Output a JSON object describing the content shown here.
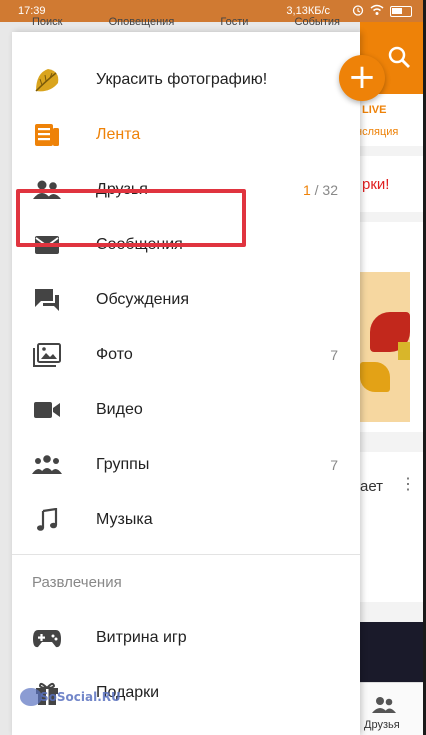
{
  "status_bar": {
    "time": "17:39",
    "network_speed": "3,13КБ/с"
  },
  "top_tabs": [
    "Поиск",
    "Оповещения",
    "Гости",
    "События"
  ],
  "menu": {
    "items": [
      {
        "label": "Украсить фотографию!",
        "icon": "leaf-icon",
        "count": ""
      },
      {
        "label": "Лента",
        "icon": "feed-icon",
        "count": ""
      },
      {
        "label": "Друзья",
        "icon": "friends-icon",
        "count_new": "1",
        "count_sep": " / ",
        "count_total": "32"
      },
      {
        "label": "Сообщения",
        "icon": "envelope-icon",
        "count": ""
      },
      {
        "label": "Обсуждения",
        "icon": "chat-icon",
        "count": ""
      },
      {
        "label": "Фото",
        "icon": "photo-icon",
        "count": "7"
      },
      {
        "label": "Видео",
        "icon": "video-icon",
        "count": ""
      },
      {
        "label": "Группы",
        "icon": "groups-icon",
        "count": "7"
      },
      {
        "label": "Музыка",
        "icon": "music-icon",
        "count": ""
      }
    ],
    "section_title": "Развлечения",
    "extra_items": [
      {
        "label": "Витрина игр",
        "icon": "gamepad-icon"
      },
      {
        "label": "Подарки",
        "icon": "gift-icon"
      }
    ]
  },
  "background": {
    "live": "LIVE",
    "translation": "нсляция",
    "red_text": "рки!",
    "partial_text": "ает",
    "bottom_nav_label": "Друзья"
  },
  "watermark": "SoSocial.RU",
  "colors": {
    "accent": "#ee8208",
    "highlight": "#e0343f"
  }
}
